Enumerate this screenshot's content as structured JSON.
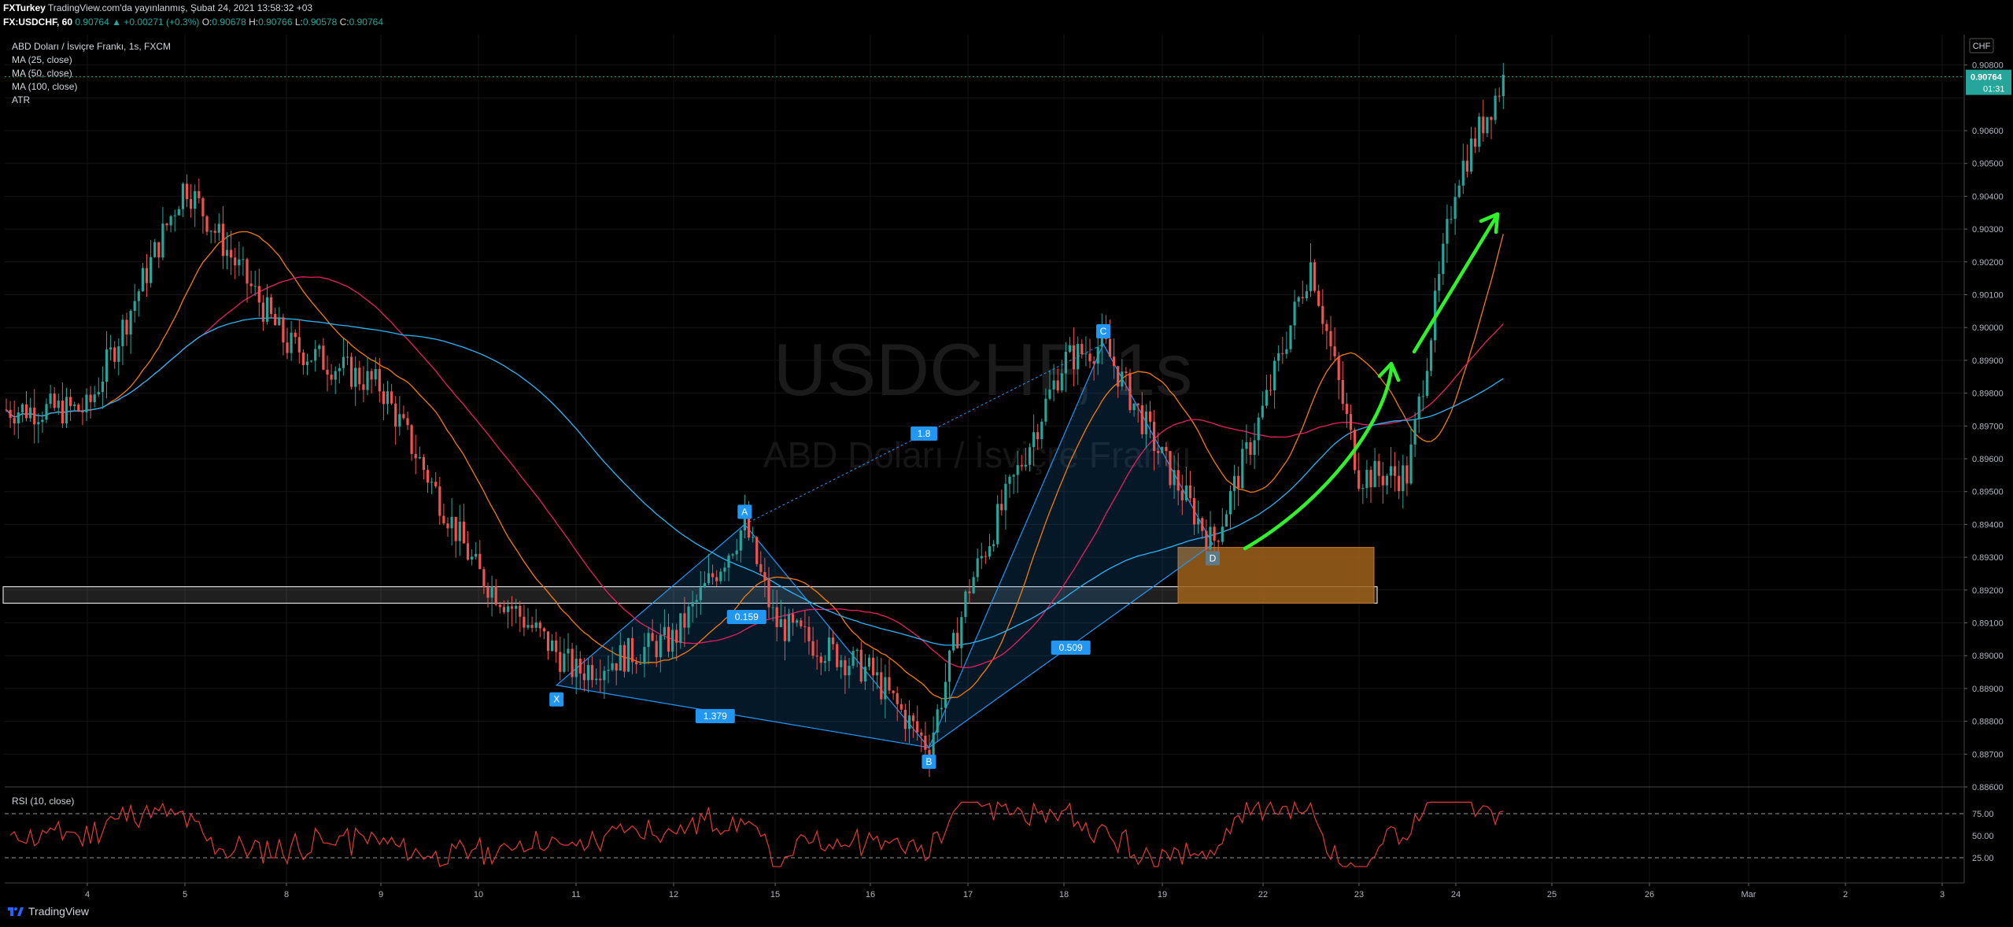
{
  "header": {
    "publisher": "FXTurkey",
    "published_text": "TradingView.com'da yayınlanmış, Şubat 24, 2021 13:58:32 +03",
    "symbol": "FX:USDCHF, 60",
    "change": "▲ +0.00271 (+0.3%)",
    "o_label": "O:",
    "o_value": "0.90678",
    "h_label": "H:",
    "h_value": "0.90766",
    "l_label": "L:",
    "l_value": "0.90578",
    "c_label": "C:",
    "c_value": "0.90764",
    "last_price": "0.90764"
  },
  "legend": {
    "title": "ABD Doları / İsviçre Frankı, 1s, FXCM",
    "ma25": "MA (25, close)",
    "ma50": "MA (50, close)",
    "ma100": "MA (100, close)",
    "atr": "ATR"
  },
  "watermark": {
    "symbol": "USDCHF, 1s",
    "name": "ABD Doları / İsviçre Frankı"
  },
  "price_axis": {
    "currency": "CHF",
    "ticks": [
      "0.90800",
      "0.90600",
      "0.90500",
      "0.90400",
      "0.90300",
      "0.90200",
      "0.90100",
      "0.90000",
      "0.89900",
      "0.89800",
      "0.89700",
      "0.89600",
      "0.89500",
      "0.89400",
      "0.89300",
      "0.89200",
      "0.89100",
      "0.89000",
      "0.88900",
      "0.88800",
      "0.88700",
      "0.88600"
    ],
    "last_label": "0.90764",
    "countdown": "01:31"
  },
  "rsi": {
    "label": "RSI (10, close)",
    "ticks": [
      "75.00",
      "50.00",
      "25.00"
    ]
  },
  "time_axis": {
    "ticks": [
      "4",
      "5",
      "8",
      "9",
      "10",
      "11",
      "12",
      "15",
      "16",
      "17",
      "18",
      "19",
      "22",
      "23",
      "24",
      "25",
      "26",
      "Mar",
      "2",
      "3"
    ]
  },
  "pattern_points": {
    "X": "X",
    "A": "A",
    "B": "B",
    "C": "C",
    "D": "D"
  },
  "ratios": {
    "xab": "0.159",
    "xb": "1.379",
    "ac": "1.8",
    "bd": "0.509"
  },
  "colors": {
    "bull": "#26a69a",
    "bear": "#ef5350",
    "ma25": "#f57c00",
    "ma50": "#e91e63",
    "ma100": "#29b6f6",
    "label_bg": "#2196f3",
    "arrow": "#31f12d",
    "zone": "#a0621a"
  },
  "footer": {
    "brand": "TradingView"
  },
  "chart_data": {
    "type": "candlestick",
    "title": "ABD Doları / İsviçre Frankı, 1s, FXCM",
    "ylabel": "CHF",
    "ylim": [
      0.886,
      0.909
    ],
    "x_axis_labels": [
      "4",
      "5",
      "8",
      "9",
      "10",
      "11",
      "12",
      "15",
      "16",
      "17",
      "18",
      "19",
      "22",
      "23",
      "24",
      "25",
      "26",
      "Mar",
      "2",
      "3"
    ],
    "last_price": 0.90764,
    "ohlc_last": {
      "open": 0.90678,
      "high": 0.90766,
      "low": 0.90578,
      "close": 0.90764
    },
    "price_path": [
      {
        "x": "4",
        "price": 0.8975
      },
      {
        "x": "5",
        "price": 0.9044
      },
      {
        "x": "8",
        "price": 0.8995
      },
      {
        "x": "9",
        "price": 0.8982
      },
      {
        "x": "10",
        "price": 0.8925
      },
      {
        "x": "11",
        "price": 0.8895
      },
      {
        "x": "12",
        "price": 0.8905
      },
      {
        "x": "12.7",
        "price": 0.894
      },
      {
        "x": "15",
        "price": 0.891
      },
      {
        "x": "16",
        "price": 0.8895
      },
      {
        "x": "16.6",
        "price": 0.8872
      },
      {
        "x": "17",
        "price": 0.892
      },
      {
        "x": "18",
        "price": 0.899
      },
      {
        "x": "18.4",
        "price": 0.8995
      },
      {
        "x": "19",
        "price": 0.896
      },
      {
        "x": "19.5",
        "price": 0.8934
      },
      {
        "x": "22",
        "price": 0.8975
      },
      {
        "x": "22.5",
        "price": 0.902
      },
      {
        "x": "23",
        "price": 0.8955
      },
      {
        "x": "23.5",
        "price": 0.8955
      },
      {
        "x": "24",
        "price": 0.9045
      },
      {
        "x": "24.5",
        "price": 0.9076
      }
    ],
    "harmonic_pattern": {
      "points": [
        {
          "name": "X",
          "x": "10.8",
          "price": 0.8891
        },
        {
          "name": "A",
          "x": "12.7",
          "price": 0.894
        },
        {
          "name": "B",
          "x": "16.6",
          "price": 0.8872
        },
        {
          "name": "C",
          "x": "18.4",
          "price": 0.8995
        },
        {
          "name": "D",
          "x": "19.5",
          "price": 0.8934
        }
      ],
      "ratios": {
        "XAB": 0.159,
        "XB": 1.379,
        "AC": 1.8,
        "BD": 0.509
      }
    },
    "series": [
      {
        "name": "MA (25, close)",
        "color": "#f57c00"
      },
      {
        "name": "MA (50, close)",
        "color": "#e91e63"
      },
      {
        "name": "MA (100, close)",
        "color": "#29b6f6"
      }
    ],
    "support_zone": [
      0.8916,
      0.8921
    ],
    "demand_zone": [
      0.8916,
      0.8933
    ],
    "rsi": {
      "name": "RSI (10, close)",
      "ylim": [
        0,
        100
      ],
      "levels": [
        75,
        50,
        25
      ]
    }
  }
}
